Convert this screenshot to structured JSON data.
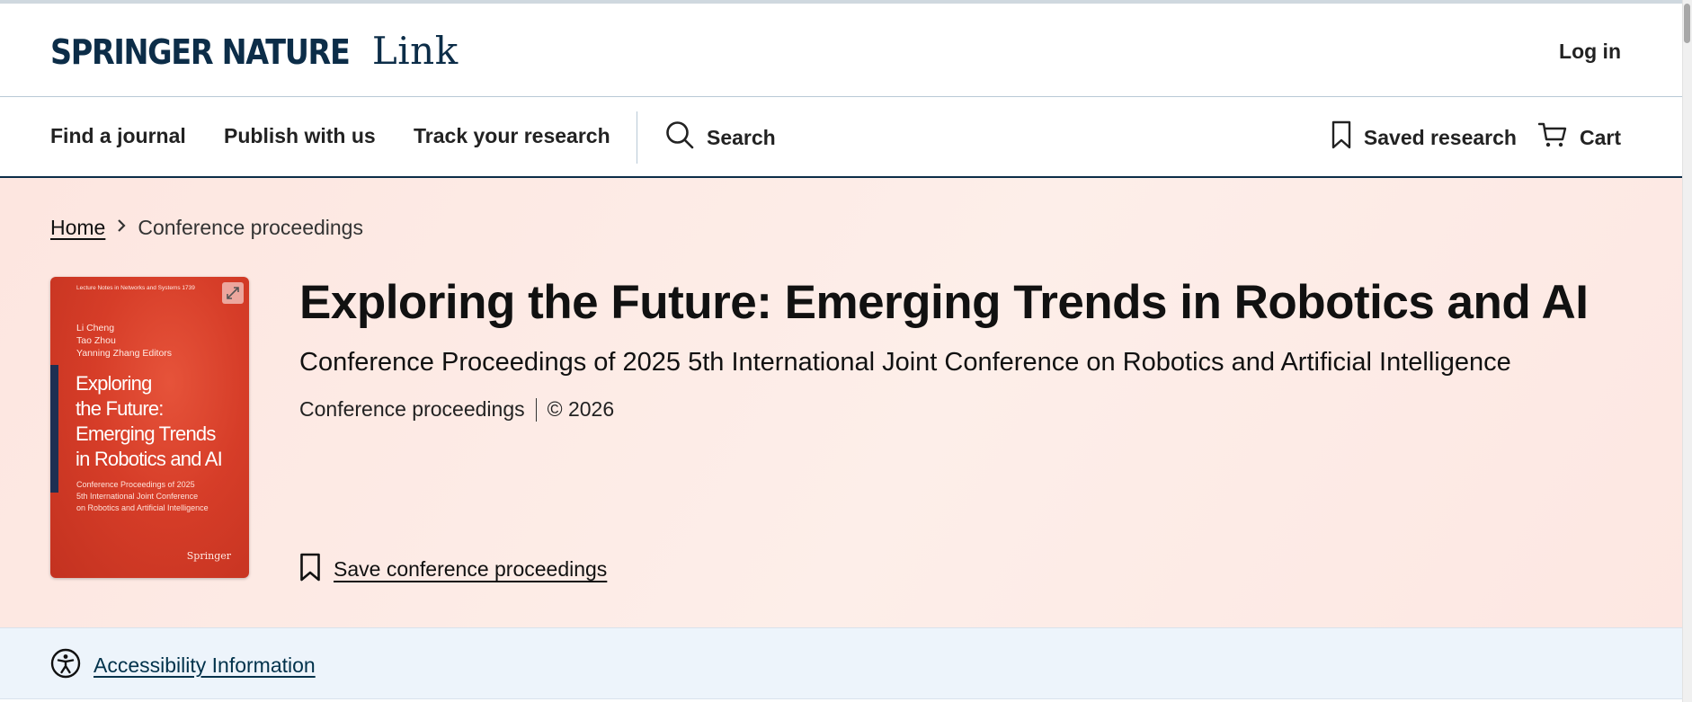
{
  "header": {
    "logo_brand": "SPRINGER NATURE",
    "logo_link": "Link",
    "login_label": "Log in"
  },
  "nav": {
    "items": [
      {
        "label": "Find a journal"
      },
      {
        "label": "Publish with us"
      },
      {
        "label": "Track your research"
      }
    ],
    "search_label": "Search",
    "saved_research_label": "Saved research",
    "cart_label": "Cart"
  },
  "breadcrumb": {
    "home": "Home",
    "current": "Conference proceedings"
  },
  "book": {
    "title": "Exploring the Future: Emerging Trends in Robotics and AI",
    "subtitle": "Conference Proceedings of 2025 5th International Joint Conference on Robotics and Artificial Intelligence",
    "type": "Conference proceedings",
    "copyright": "© 2026",
    "save_label": "Save conference proceedings"
  },
  "cover": {
    "series": "Lecture Notes in Networks and Systems  1739",
    "authors": [
      "Li Cheng",
      "Tao Zhou",
      "Yanning Zhang  Editors"
    ],
    "title_lines": [
      "Exploring",
      "the Future:",
      "Emerging Trends",
      "in Robotics and AI"
    ],
    "subtitle_lines": [
      "Conference Proceedings of 2025",
      "5th International Joint Conference",
      "on Robotics and Artificial Intelligence"
    ],
    "publisher": "Springer"
  },
  "accessibility": {
    "link_label": "Accessibility Information"
  },
  "colors": {
    "brand_navy": "#0c2d48",
    "hero_bg": "#fdeae5",
    "cover_red": "#d63d28",
    "a11y_bg": "#edf4fb",
    "a11y_link": "#01324b"
  },
  "icons": {
    "search": "search-icon",
    "saved": "bookmark-icon",
    "cart": "cart-icon",
    "breadcrumb_sep": "chevron-right-icon",
    "expand": "expand-icon",
    "save": "bookmark-icon",
    "accessibility": "accessibility-icon"
  }
}
